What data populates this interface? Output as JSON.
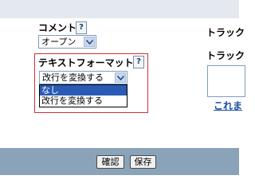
{
  "comment": {
    "label": "コメント",
    "help": "?",
    "select_value": "オープン"
  },
  "text_format": {
    "label": "テキストフォーマット",
    "help": "?",
    "select_value": "改行を変換する",
    "options": [
      "なし",
      "改行を変換する"
    ],
    "highlighted_option": "なし"
  },
  "trackback": {
    "label1": "トラック",
    "label2": "トラック",
    "link": "これま"
  },
  "buttons": {
    "confirm": "確認",
    "save": "保存"
  },
  "colors": {
    "highlight_border": "#cc3333",
    "selected_option": "#2b5bb5",
    "bottom_bar": "#8aa3b9",
    "link": "#1a4da1"
  }
}
